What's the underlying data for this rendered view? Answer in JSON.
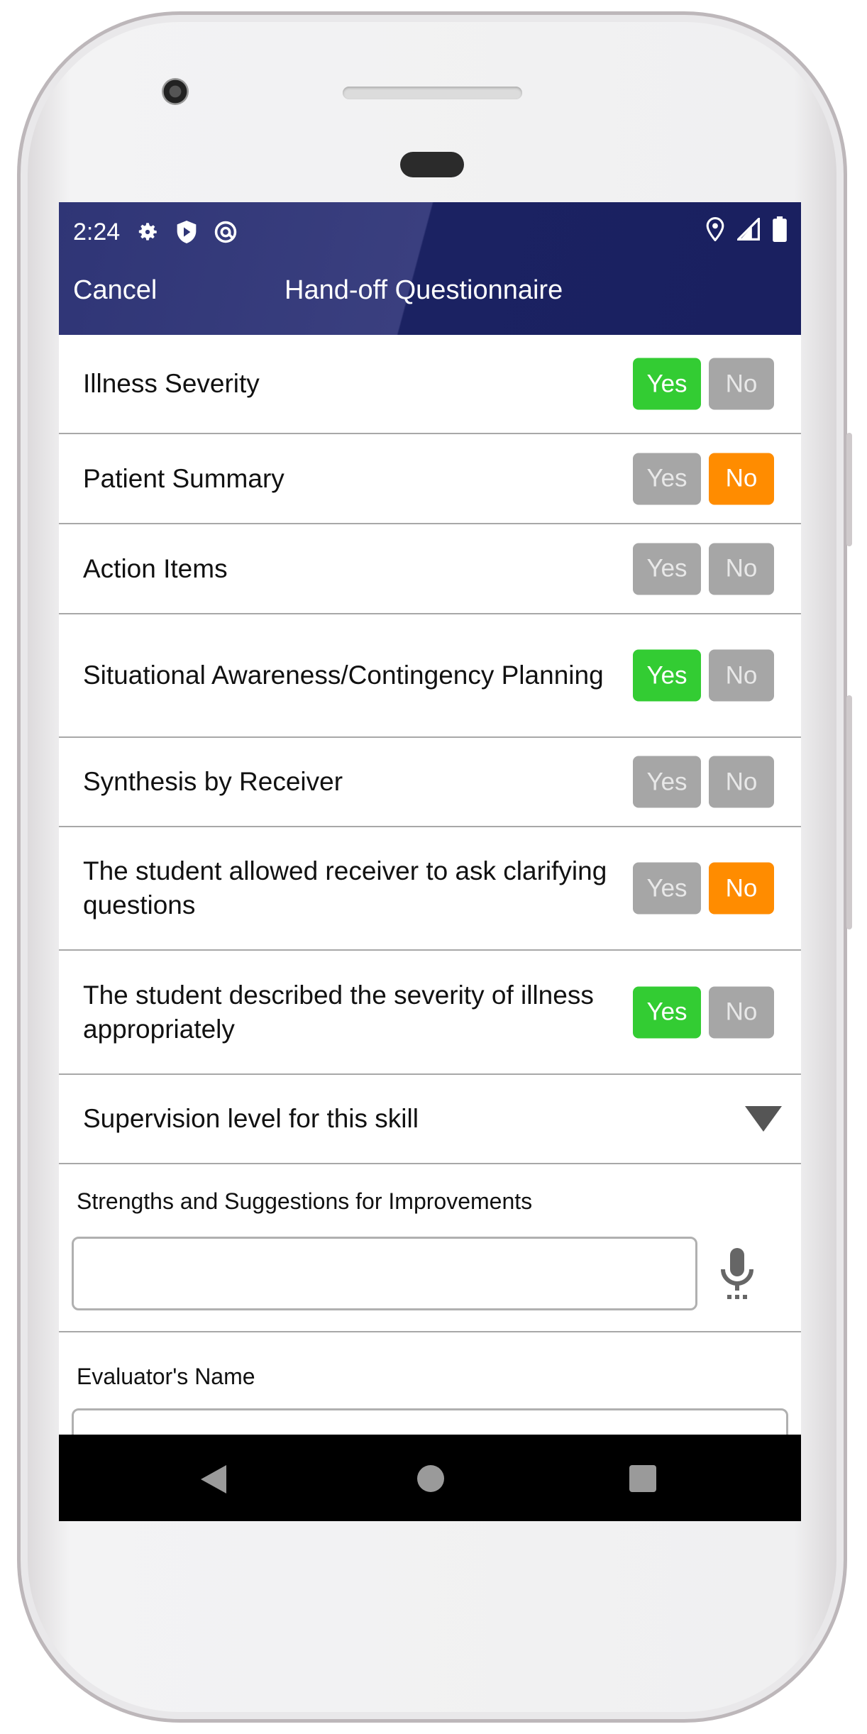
{
  "status_bar": {
    "time": "2:24",
    "left_icons": [
      "gear-icon",
      "shield-play-icon",
      "at-sign-icon"
    ],
    "right_icons": [
      "location-icon",
      "signal-icon",
      "battery-icon"
    ]
  },
  "header": {
    "cancel_label": "Cancel",
    "title": "Hand-off Questionnaire",
    "color": "#1a2060"
  },
  "questions": [
    {
      "label": "Illness Severity",
      "yes": "Yes",
      "no": "No",
      "selected": "yes"
    },
    {
      "label": "Patient Summary",
      "yes": "Yes",
      "no": "No",
      "selected": "no"
    },
    {
      "label": "Action Items",
      "yes": "Yes",
      "no": "No",
      "selected": null
    },
    {
      "label": "Situational Awareness/Contingency Planning",
      "yes": "Yes",
      "no": "No",
      "selected": "yes"
    },
    {
      "label": "Synthesis by Receiver",
      "yes": "Yes",
      "no": "No",
      "selected": null
    },
    {
      "label": "The student allowed receiver to ask clarifying questions",
      "yes": "Yes",
      "no": "No",
      "selected": "no"
    },
    {
      "label": "The student described the severity of illness appropriately",
      "yes": "Yes",
      "no": "No",
      "selected": "yes"
    }
  ],
  "colors": {
    "yes_selected": "#33cc33",
    "no_selected": "#ff8c00",
    "unselected": "#a6a6a6"
  },
  "supervision": {
    "label": "Supervision level for this skill",
    "value": ""
  },
  "strengths": {
    "label": "Strengths and Suggestions for Improvements",
    "value": ""
  },
  "evaluator": {
    "label": "Evaluator's Name",
    "value": ""
  },
  "nav": [
    "back-icon",
    "home-icon",
    "recents-icon"
  ]
}
